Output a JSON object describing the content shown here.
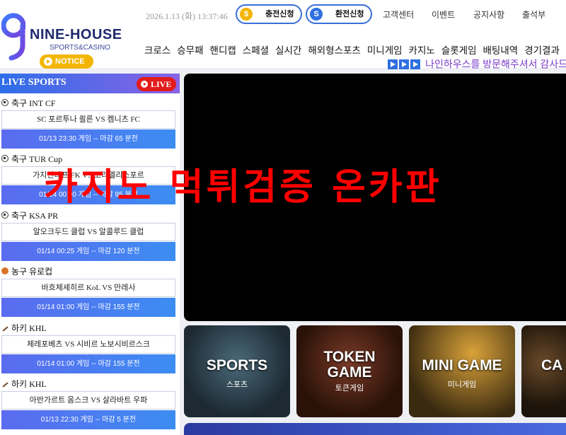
{
  "header": {
    "logo_title": "NINE-HOUSE",
    "logo_subtitle": "SPORTS&CASINO",
    "notice_label": "NOTICE",
    "datetime": "2026.1.13 (화) 13:37:46",
    "charge_label": "충전신청",
    "exchange_label": "환전신청",
    "top_links": [
      "고객센터",
      "이벤트",
      "공지사항",
      "출석부"
    ],
    "nav": [
      "크로스",
      "승무패",
      "핸디캡",
      "스페셜",
      "실시간",
      "해외형스포츠",
      "미니게임",
      "카지노",
      "슬롯게임",
      "배팅내역",
      "경기결과"
    ],
    "marquee": "나인하우스를 방문해주셔서 감사드"
  },
  "live": {
    "title": "LIVE SPORTS",
    "badge": "LIVE",
    "matches": [
      {
        "league": "축구 INT CF",
        "teams": "SC 포르투나 쾰른 VS 켐니츠 FC",
        "time": "01/13 23:30 게임 -- 마감 65 분전"
      },
      {
        "league": "축구 TUR Cup",
        "teams": "가지안테프 FK VS 코라엘리스포르",
        "time": "01/14 00:00 게임 -- 마감 95 분전"
      },
      {
        "league": "축구 KSA PR",
        "teams": "알오크두드 클럽 VS 알콜루드 클럽",
        "time": "01/14 00:25 게임 -- 마감 120 분전"
      },
      {
        "league": "농구 유로컵",
        "teams": "바흐체셰히르 KoL VS 만레사",
        "time": "01/14 01:00 게임 -- 마감 155 분전"
      },
      {
        "league": "하키 KHL",
        "teams": "체레포베츠 VS 시비르 노보시비르스크",
        "time": "01/14 01:00 게임 -- 마감 155 분전"
      },
      {
        "league": "하키 KHL",
        "teams": "아반가르트 옴스크 VS 살라바트 우파",
        "time": "01/13 22:30 게임 -- 마감 5 분전"
      }
    ]
  },
  "overlay": "카지노 먹튀검증 온카판",
  "tiles": {
    "sports": {
      "title": "SPORTS",
      "sub": "스포츠"
    },
    "token": {
      "title1": "TOKEN",
      "title2": "GAME",
      "sub": "토큰게임"
    },
    "mini": {
      "title": "MINI GAME",
      "sub": "미니게임"
    },
    "casino": {
      "title": "CA"
    }
  },
  "colors": {
    "accent": "#2f6fe0",
    "live_red": "#e21b1b",
    "overlay_red": "#ff0000",
    "notice_yellow": "#f2b600"
  }
}
